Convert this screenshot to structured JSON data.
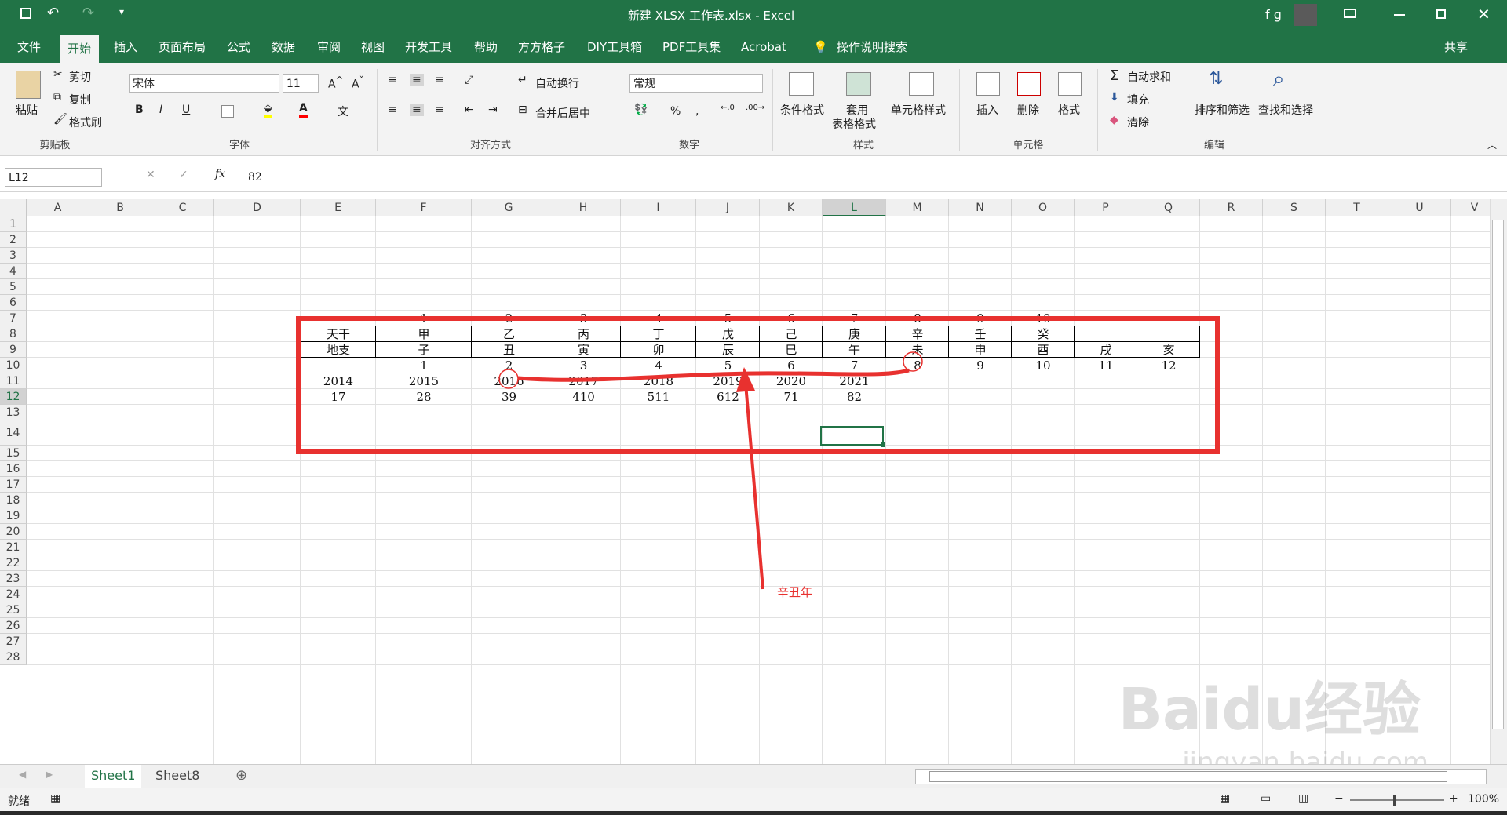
{
  "titlebar": {
    "title": "新建 XLSX 工作表.xlsx  -  Excel",
    "user": "f g"
  },
  "tabs": [
    "文件",
    "开始",
    "插入",
    "页面布局",
    "公式",
    "数据",
    "审阅",
    "视图",
    "开发工具",
    "帮助",
    "方方格子",
    "DIY工具箱",
    "PDF工具集",
    "Acrobat"
  ],
  "tellme": "操作说明搜索",
  "share": "共享",
  "ribbon": {
    "paste": "粘贴",
    "cut": "剪切",
    "copy": "复制",
    "format_painter": "格式刷",
    "clipboard": "剪贴板",
    "font_name": "宋体",
    "font_size": "11",
    "font_group": "字体",
    "wrap": "自动换行",
    "merge": "合并后居中",
    "align_group": "对齐方式",
    "number_format": "常规",
    "number_group": "数字",
    "cond": "条件格式",
    "table1": "套用",
    "table2": "表格格式",
    "cellstyle": "单元格样式",
    "style_group": "样式",
    "insert": "插入",
    "delete": "删除",
    "format": "格式",
    "cells_group": "单元格",
    "autosum": "自动求和",
    "fill": "填充",
    "clear": "清除",
    "sort": "排序和筛选",
    "find": "查找和选择",
    "edit_group": "编辑"
  },
  "formula": {
    "namebox": "L12",
    "value": "82"
  },
  "columns": [
    "A",
    "B",
    "C",
    "D",
    "E",
    "F",
    "G",
    "H",
    "I",
    "J",
    "K",
    "L",
    "M",
    "N",
    "O",
    "P",
    "Q",
    "R",
    "S",
    "T",
    "U",
    "V"
  ],
  "rows": [
    "1",
    "2",
    "3",
    "4",
    "5",
    "6",
    "7",
    "8",
    "9",
    "10",
    "11",
    "12",
    "13",
    "14",
    "15",
    "16",
    "17",
    "18",
    "19",
    "20",
    "21",
    "22",
    "23",
    "24",
    "25",
    "26",
    "27",
    "28"
  ],
  "cells": {
    "r7": [
      "1",
      "2",
      "3",
      "4",
      "5",
      "6",
      "7",
      "8",
      "9",
      "10"
    ],
    "r8": [
      "天干",
      "甲",
      "乙",
      "丙",
      "丁",
      "戊",
      "己",
      "庚",
      "辛",
      "壬",
      "癸"
    ],
    "r9": [
      "地支",
      "子",
      "丑",
      "寅",
      "卯",
      "辰",
      "巳",
      "午",
      "未",
      "申",
      "酉",
      "戌",
      "亥"
    ],
    "r10": [
      "1",
      "2",
      "3",
      "4",
      "5",
      "6",
      "7",
      "8",
      "9",
      "10",
      "11",
      "12"
    ],
    "r11": [
      "2014",
      "2015",
      "2016",
      "2017",
      "2018",
      "2019",
      "2020",
      "2021"
    ],
    "r12": [
      "17",
      "28",
      "39",
      "410",
      "511",
      "612",
      "71",
      "82"
    ]
  },
  "annotation": "辛丑年",
  "sheets": [
    "Sheet1",
    "Sheet8"
  ],
  "status": {
    "ready": "就绪",
    "zoom": "100%"
  },
  "watermark": {
    "main": "Baidu经验",
    "sub": "jingyan.baidu.com"
  },
  "colors": {
    "excel_green": "#217346",
    "annotation_red": "#e8312f"
  }
}
